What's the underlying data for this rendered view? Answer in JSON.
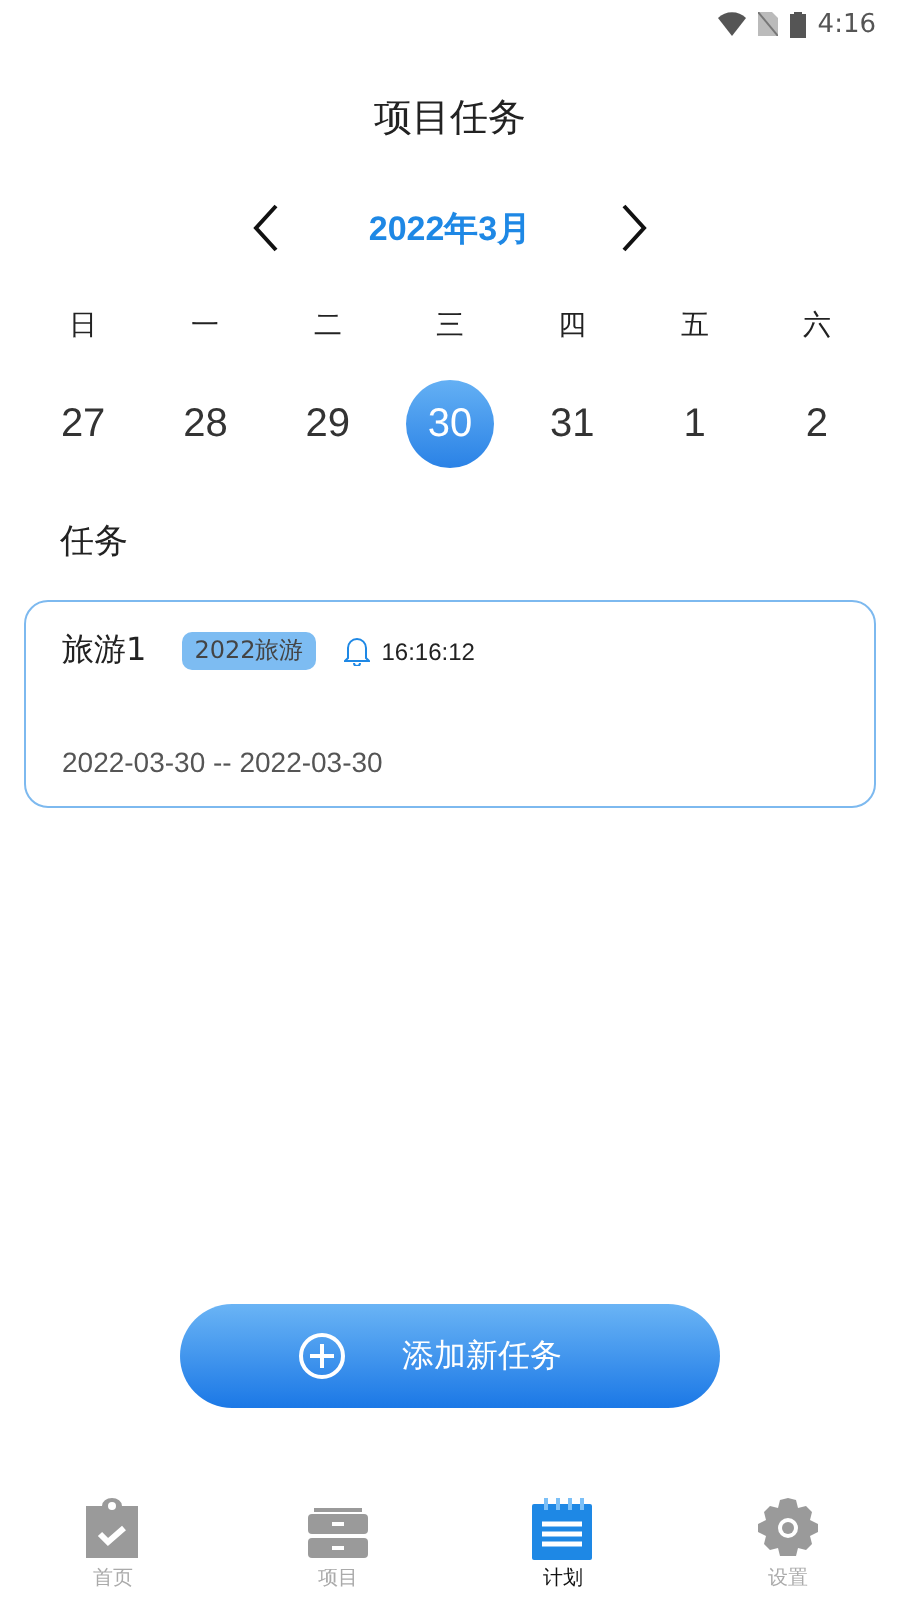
{
  "status_bar": {
    "time": "4:16"
  },
  "title": "项目任务",
  "month_nav": {
    "label": "2022年3月"
  },
  "weekdays": [
    "日",
    "一",
    "二",
    "三",
    "四",
    "五",
    "六"
  ],
  "days": [
    {
      "label": "27",
      "selected": false
    },
    {
      "label": "28",
      "selected": false
    },
    {
      "label": "29",
      "selected": false
    },
    {
      "label": "30",
      "selected": true
    },
    {
      "label": "31",
      "selected": false
    },
    {
      "label": "1",
      "selected": false
    },
    {
      "label": "2",
      "selected": false
    }
  ],
  "section_title": "任务",
  "tasks": [
    {
      "name": "旅游1",
      "tag": "2022旅游",
      "reminder": "16:16:12",
      "dates": "2022-03-30 -- 2022-03-30"
    }
  ],
  "add_button": {
    "label": "添加新任务"
  },
  "tab_bar": [
    {
      "label": "首页",
      "kind": "clipboard",
      "selected": false
    },
    {
      "label": "项目",
      "kind": "drawer",
      "selected": false
    },
    {
      "label": "计划",
      "kind": "notepad",
      "selected": true
    },
    {
      "label": "设置",
      "kind": "gear",
      "selected": false
    }
  ]
}
